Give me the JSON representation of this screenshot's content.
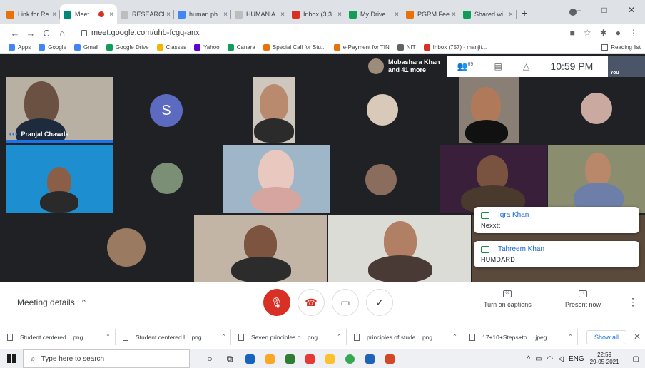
{
  "browser": {
    "tabs": [
      {
        "title": "Link for Re",
        "color": "#e8710a",
        "active": false
      },
      {
        "title": "Meet",
        "color": "#00897b",
        "active": true,
        "recording": true
      },
      {
        "title": "RESEARCH",
        "color": "#bdbdbd",
        "active": false
      },
      {
        "title": "human ph",
        "color": "#4285f4",
        "active": false
      },
      {
        "title": "HUMAN A",
        "color": "#bdbdbd",
        "active": false
      },
      {
        "title": "Inbox (3,3",
        "color": "#d93025",
        "active": false
      },
      {
        "title": "My Drive",
        "color": "#0f9d58",
        "active": false
      },
      {
        "title": "PGRM Fee",
        "color": "#e8710a",
        "active": false
      },
      {
        "title": "Shared wi",
        "color": "#0f9d58",
        "active": false
      }
    ],
    "tab_close": "×",
    "new_tab": "+",
    "url": "meet.google.com/uhb-fcgq-anx",
    "bookmarks": [
      {
        "label": "Apps",
        "color": "#4285f4"
      },
      {
        "label": "Google",
        "color": "#4285f4"
      },
      {
        "label": "Gmail",
        "color": "#4285f4"
      },
      {
        "label": "Google Drive",
        "color": "#0f9d58"
      },
      {
        "label": "Classes",
        "color": "#f4b400"
      },
      {
        "label": "Yahoo",
        "color": "#6001d2"
      },
      {
        "label": "Canara",
        "color": "#0f9d58"
      },
      {
        "label": "Special Call for Stu...",
        "color": "#e8710a"
      },
      {
        "label": "e-Payment for TIN",
        "color": "#e8710a"
      },
      {
        "label": "NIT",
        "color": "#5f6368"
      },
      {
        "label": "Inbox (757) - manjit...",
        "color": "#d93025"
      }
    ],
    "reading_list": "Reading list"
  },
  "meet": {
    "presenter_chip": {
      "line1": "Mubashara Khan",
      "line2": "and 41 more"
    },
    "participant_count": "69",
    "clock": "10:59 PM",
    "self_label": "You",
    "avatar_letter": "S",
    "tiles": [
      {
        "name": "Pranjal Chawda"
      }
    ],
    "chat_messages": [
      {
        "author": "Iqra Khan",
        "text": "Nexxtt"
      },
      {
        "author": "Tahreem Khan",
        "text": "HUMDARD"
      }
    ],
    "meeting_details": "Meeting details",
    "captions": "Turn on captions",
    "present": "Present now"
  },
  "downloads": {
    "items": [
      {
        "name": "Student centered....png"
      },
      {
        "name": "Student centered l....png"
      },
      {
        "name": "Seven principles o....png"
      },
      {
        "name": "principles of stude....png"
      },
      {
        "name": "17+10+Steps+to.....jpeg"
      }
    ],
    "show_all": "Show all"
  },
  "taskbar": {
    "search_placeholder": "Type here to search",
    "lang": "ENG",
    "time": "22:59",
    "date": "29-05-2021"
  }
}
